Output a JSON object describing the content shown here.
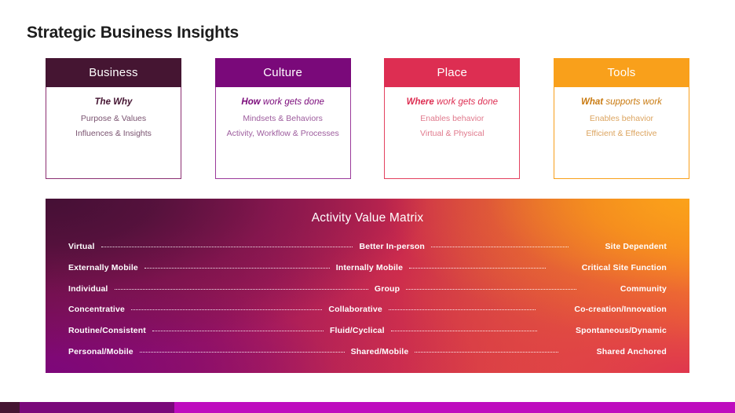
{
  "slide": {
    "title": "Strategic Business Insights"
  },
  "cards": [
    {
      "key": "business",
      "header": "Business",
      "lead_bold": "The Why",
      "lead_rest": "",
      "sublines": [
        "Purpose & Values",
        "Influences & Insights"
      ],
      "header_color": "#451532",
      "border_color": "#8c2f72",
      "text_color": "#451532"
    },
    {
      "key": "culture",
      "header": "Culture",
      "lead_bold": "How",
      "lead_rest": " work gets done",
      "sublines": [
        "Mindsets & Behaviors",
        "Activity, Workflow & Processes"
      ],
      "header_color": "#7A097A",
      "border_color": "#9B3A9B",
      "text_color": "#7A097A"
    },
    {
      "key": "place",
      "header": "Place",
      "lead_bold": "Where",
      "lead_rest": " work gets done",
      "sublines": [
        "Enables behavior",
        "Virtual & Physical"
      ],
      "header_color": "#DD2E52",
      "border_color": "#E3415F",
      "text_color": "#DD2E52"
    },
    {
      "key": "tools",
      "header": "Tools",
      "lead_bold": "What",
      "lead_rest": " supports work",
      "sublines": [
        "Enables behavior",
        "Efficient & Effective"
      ],
      "header_color": "#F9A01B",
      "border_color": "#F9A01B",
      "text_color": "#C97A10"
    }
  ],
  "matrix": {
    "title": "Activity Value Matrix",
    "gradient": {
      "top_left": "#451035",
      "top_right": "#FBA21A",
      "bottom_left": "#7D067D",
      "bottom_right": "#DD2E52"
    },
    "rows": [
      {
        "left": "Virtual",
        "middle": "Better In-person",
        "right": "Site Dependent"
      },
      {
        "left": "Externally Mobile",
        "middle": "Internally Mobile",
        "right": "Critical Site Function"
      },
      {
        "left": "Individual",
        "middle": "Group",
        "right": "Community"
      },
      {
        "left": "Concentrative",
        "middle": "Collaborative",
        "right": "Co-creation/Innovation"
      },
      {
        "left": "Routine/Consistent",
        "middle": "Fluid/Cyclical",
        "right": "Spontaneous/Dynamic"
      },
      {
        "left": "Personal/Mobile",
        "middle": "Shared/Mobile",
        "right": "Shared Anchored"
      }
    ]
  },
  "bottom_bar": {
    "segments": [
      {
        "color": "#451532"
      },
      {
        "color": "#7A097A"
      },
      {
        "color": "#BE0CBE"
      }
    ]
  }
}
